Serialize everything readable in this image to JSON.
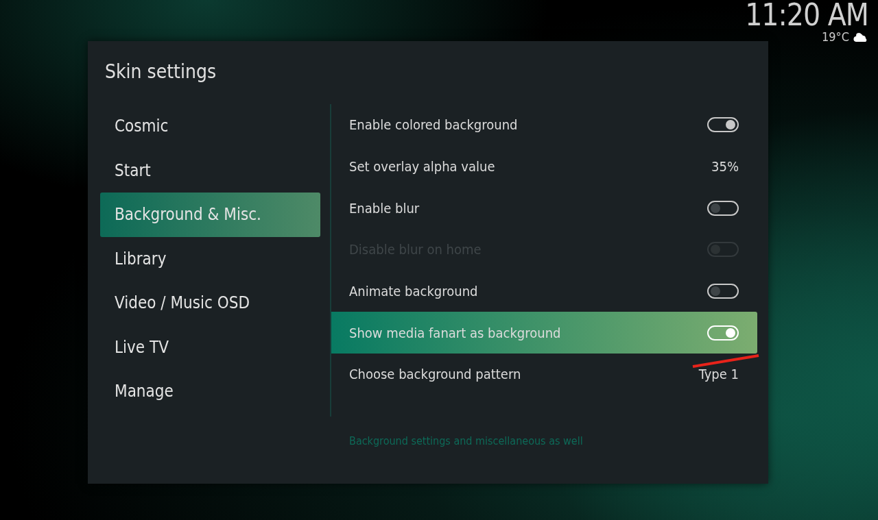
{
  "clock": {
    "time": "11:20 AM",
    "temperature": "19°C"
  },
  "dialog": {
    "title": "Skin settings"
  },
  "categories": [
    {
      "label": "Cosmic",
      "selected": false
    },
    {
      "label": "Start",
      "selected": false
    },
    {
      "label": "Background & Misc.",
      "selected": true
    },
    {
      "label": "Library",
      "selected": false
    },
    {
      "label": "Video / Music OSD",
      "selected": false
    },
    {
      "label": "Live TV",
      "selected": false
    },
    {
      "label": "Manage",
      "selected": false
    }
  ],
  "settings": [
    {
      "kind": "toggle",
      "label": "Enable colored background",
      "on": true,
      "disabled": false,
      "selected": false
    },
    {
      "kind": "value",
      "label": "Set overlay alpha value",
      "value": "35%",
      "disabled": false,
      "selected": false
    },
    {
      "kind": "toggle",
      "label": "Enable blur",
      "on": false,
      "disabled": false,
      "selected": false
    },
    {
      "kind": "toggle",
      "label": "Disable blur on home",
      "on": false,
      "disabled": true,
      "selected": false
    },
    {
      "kind": "toggle",
      "label": "Animate background",
      "on": false,
      "disabled": false,
      "selected": false
    },
    {
      "kind": "toggle",
      "label": "Show media fanart as background",
      "on": true,
      "disabled": false,
      "selected": true
    },
    {
      "kind": "value",
      "label": "Choose background pattern",
      "value": "Type 1",
      "disabled": false,
      "selected": false
    }
  ],
  "description": "Background settings and miscellaneous as well"
}
